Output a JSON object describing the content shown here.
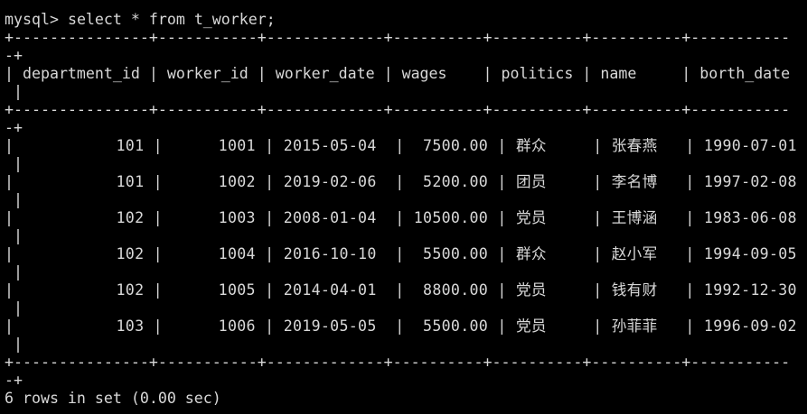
{
  "terminal": {
    "prompt": "mysql>",
    "command": "select * from t_worker;",
    "border": "+---------------+-----------+-------------+----------+----------+----------+-----------",
    "border_wrap": "-+",
    "row_wrap": " |",
    "header": "| department_id | worker_id | worker_date | wages    | politics | name     | borth_date",
    "rows": [
      "|           101 |      1001 | 2015-05-04  |  7500.00 | 群众     | 张春燕   | 1990-07-01",
      "|           101 |      1002 | 2019-02-06  |  5200.00 | 团员     | 李名博   | 1997-02-08",
      "|           102 |      1003 | 2008-01-04  | 10500.00 | 党员     | 王博涵   | 1983-06-08",
      "|           102 |      1004 | 2016-10-10  |  5500.00 | 群众     | 赵小军   | 1994-09-05",
      "|           102 |      1005 | 2014-04-01  |  8800.00 | 党员     | 钱有财   | 1992-12-30",
      "|           103 |      1006 | 2019-05-05  |  5500.00 | 党员     | 孙菲菲   | 1996-09-02"
    ],
    "status": "6 rows in set (0.00 sec)"
  }
}
